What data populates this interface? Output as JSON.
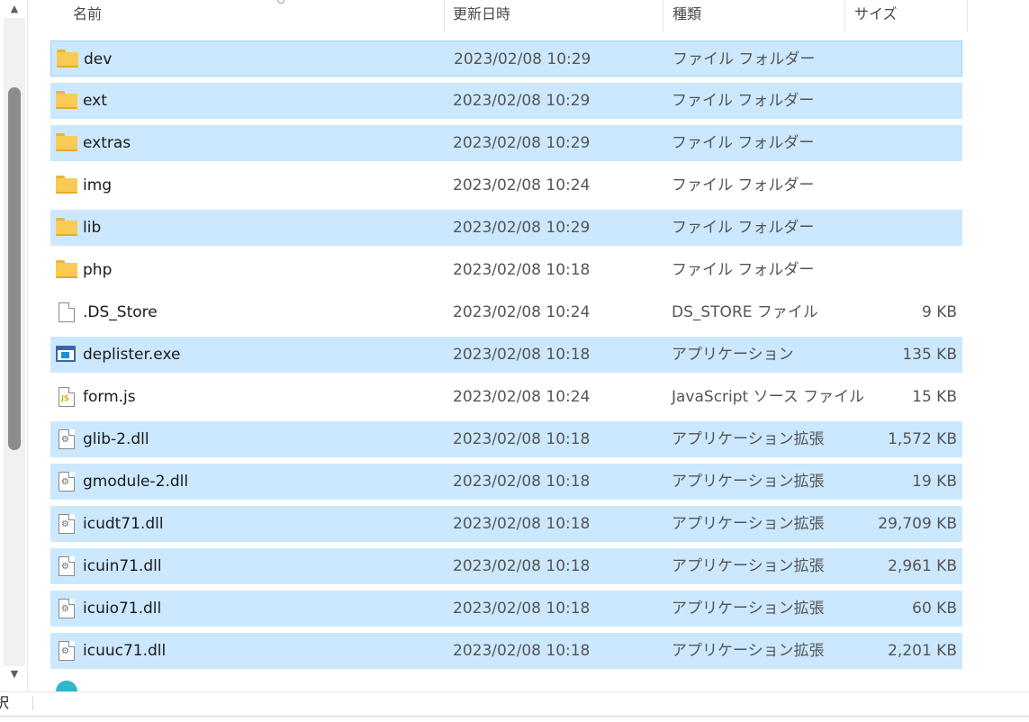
{
  "header": {
    "name": "名前",
    "date": "更新日時",
    "type": "種類",
    "size": "サイズ"
  },
  "files": [
    {
      "name": "dev",
      "date": "2023/02/08 10:29",
      "type": "ファイル フォルダー",
      "size": "",
      "icon": "folder-icon",
      "selected": true
    },
    {
      "name": "ext",
      "date": "2023/02/08 10:29",
      "type": "ファイル フォルダー",
      "size": "",
      "icon": "folder-icon",
      "selected": true
    },
    {
      "name": "extras",
      "date": "2023/02/08 10:29",
      "type": "ファイル フォルダー",
      "size": "",
      "icon": "folder-icon",
      "selected": true
    },
    {
      "name": "img",
      "date": "2023/02/08 10:24",
      "type": "ファイル フォルダー",
      "size": "",
      "icon": "folder-icon",
      "selected": false
    },
    {
      "name": "lib",
      "date": "2023/02/08 10:29",
      "type": "ファイル フォルダー",
      "size": "",
      "icon": "folder-icon",
      "selected": true
    },
    {
      "name": "php",
      "date": "2023/02/08 10:18",
      "type": "ファイル フォルダー",
      "size": "",
      "icon": "folder-icon",
      "selected": false
    },
    {
      "name": ".DS_Store",
      "date": "2023/02/08 10:24",
      "type": "DS_STORE ファイル",
      "size": "9 KB",
      "icon": "blank-file-icon",
      "selected": false
    },
    {
      "name": "deplister.exe",
      "date": "2023/02/08 10:18",
      "type": "アプリケーション",
      "size": "135 KB",
      "icon": "application-icon",
      "selected": true
    },
    {
      "name": "form.js",
      "date": "2023/02/08 10:24",
      "type": "JavaScript ソース ファイル",
      "size": "15 KB",
      "icon": "javascript-file-icon",
      "selected": false
    },
    {
      "name": "glib-2.dll",
      "date": "2023/02/08 10:18",
      "type": "アプリケーション拡張",
      "size": "1,572 KB",
      "icon": "dll-file-icon",
      "selected": true
    },
    {
      "name": "gmodule-2.dll",
      "date": "2023/02/08 10:18",
      "type": "アプリケーション拡張",
      "size": "19 KB",
      "icon": "dll-file-icon",
      "selected": true
    },
    {
      "name": "icudt71.dll",
      "date": "2023/02/08 10:18",
      "type": "アプリケーション拡張",
      "size": "29,709 KB",
      "icon": "dll-file-icon",
      "selected": true
    },
    {
      "name": "icuin71.dll",
      "date": "2023/02/08 10:18",
      "type": "アプリケーション拡張",
      "size": "2,961 KB",
      "icon": "dll-file-icon",
      "selected": true
    },
    {
      "name": "icuio71.dll",
      "date": "2023/02/08 10:18",
      "type": "アプリケーション拡張",
      "size": "60 KB",
      "icon": "dll-file-icon",
      "selected": true
    },
    {
      "name": "icuuc71.dll",
      "date": "2023/02/08 10:18",
      "type": "アプリケーション拡張",
      "size": "2,201 KB",
      "icon": "dll-file-icon",
      "selected": true
    }
  ],
  "status": {
    "text": "択"
  },
  "colors": {
    "selection": "#cce8ff",
    "selection_border": "#99d1ff",
    "folder": "#f9cb54"
  }
}
